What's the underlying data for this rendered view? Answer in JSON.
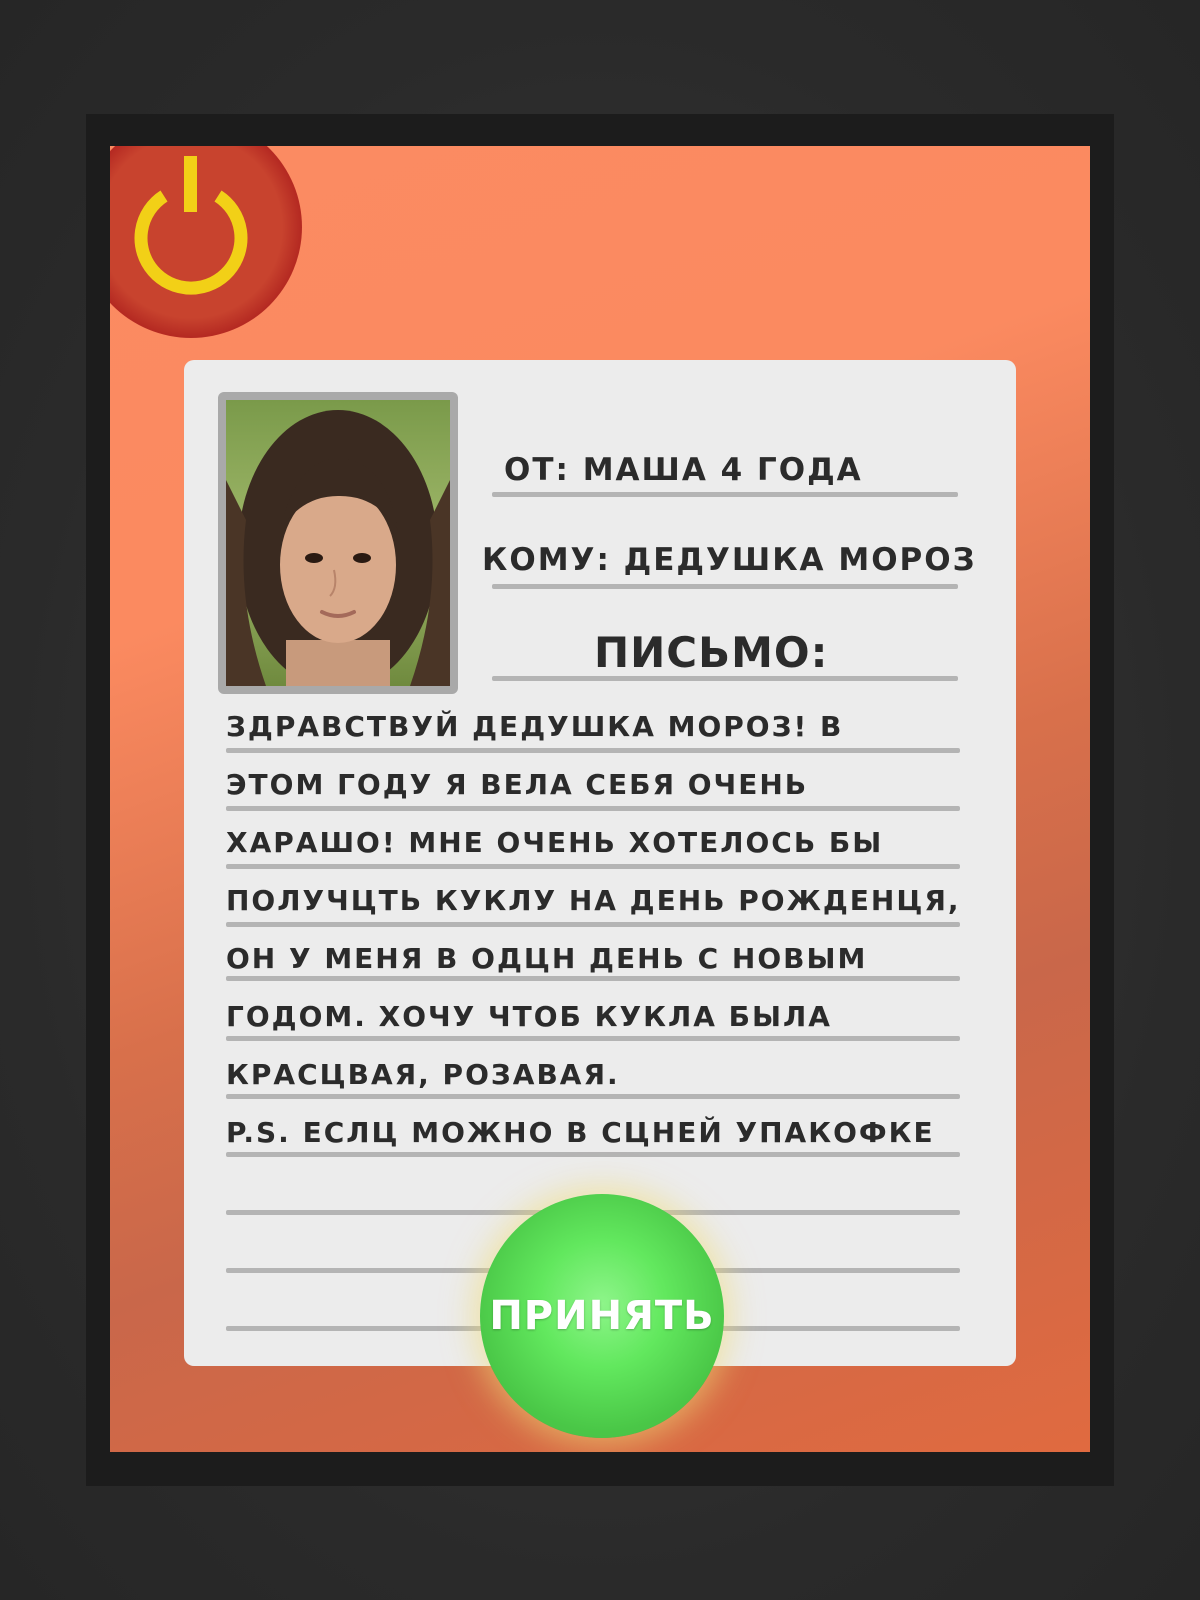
{
  "colors": {
    "background": "#2a2a2a",
    "frame": "#1c1c1c",
    "screen": "#fb8a60",
    "card": "#ececec",
    "rule": "#b4b4b4",
    "power_button": "#c8432e",
    "power_icon": "#f2d017",
    "accept_button": "#62e85e",
    "text": "#2b2b2b"
  },
  "power_button": {
    "icon": "power-icon"
  },
  "letter": {
    "photo": "girl-portrait-photo",
    "from": "ОТ: МАША 4 ГОДА",
    "to": "КОМУ: ДЕДУШКА МОРОЗ",
    "title": "ПИСЬМО:",
    "lines": [
      "ЗДРАВСТВУЙ ДЕДУШКА МОРОЗ! В",
      "ЭТОМ ГОДУ Я ВЕЛА СЕБЯ ОЧЕНЬ",
      "ХАРАШО! МНЕ ОЧЕНЬ ХОТЕЛОСЬ БЫ",
      "ПОЛУЧЦТЬ КУКЛУ НА ДЕНЬ РОЖДЕНЦЯ,",
      "ОН У МЕНЯ В ОДЦН ДЕНЬ С НОВЫМ",
      "ГОДОМ. ХОЧУ ЧТОБ КУКЛА БЫЛА",
      "КРАСЦВАЯ, РОЗАВАЯ.",
      "P.S. ЕСЛЦ МОЖНО В СЦНЕЙ УПАКОФКЕ"
    ]
  },
  "accept_button": {
    "label": "ПРИНЯТЬ"
  }
}
